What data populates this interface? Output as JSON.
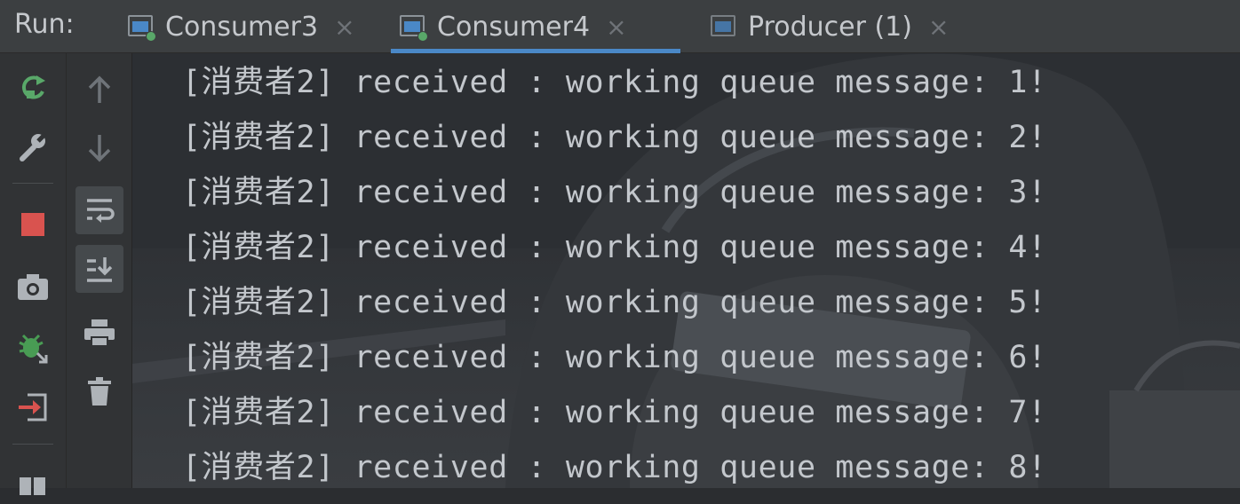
{
  "run": {
    "label": "Run:"
  },
  "tabs": [
    {
      "title": "Consumer3",
      "close": "×",
      "active": false,
      "running": true
    },
    {
      "title": "Consumer4",
      "close": "×",
      "active": true,
      "running": true
    },
    {
      "title": "Producer (1)",
      "close": "×",
      "active": false,
      "running": false
    }
  ],
  "toolbar_left": [
    "rerun-icon",
    "wrench-icon",
    "stop-icon",
    "camera-icon",
    "debug-icon",
    "exit-icon",
    "layout-icon"
  ],
  "toolbar_right": [
    "arrow-up-icon",
    "arrow-down-icon",
    "soft-wrap-icon",
    "scroll-to-end-icon",
    "print-icon",
    "trash-icon"
  ],
  "colors": {
    "accent": "#4a88c7",
    "stop": "#d9534f",
    "run_green": "#59a869",
    "debug_green": "#499c54"
  },
  "console": {
    "lines": [
      "[消费者2] received : working queue message: 1!",
      "[消费者2] received : working queue message: 2!",
      "[消费者2] received : working queue message: 3!",
      "[消费者2] received : working queue message: 4!",
      "[消费者2] received : working queue message: 5!",
      "[消费者2] received : working queue message: 6!",
      "[消费者2] received : working queue message: 7!",
      "[消费者2] received : working queue message: 8!"
    ]
  }
}
